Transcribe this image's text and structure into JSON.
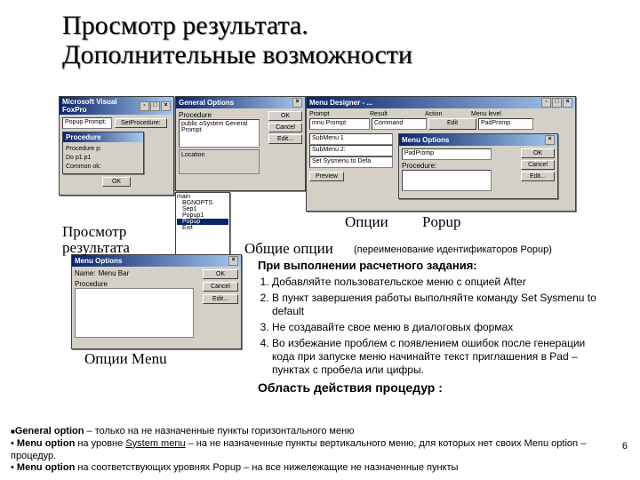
{
  "title_line1": "Просмотр результата.",
  "title_line2": "Дополнительные возможности",
  "labels": {
    "options": "Опции",
    "popup": "Popup",
    "general_options": "Общие опции",
    "popup_rename": "(переименование идентификаторов Popup)",
    "view_result": "Просмотр результата",
    "options_menu": "Опции Menu"
  },
  "text": {
    "heading1": "При выполнении расчетного задания:",
    "heading2": "Область действия процедур :",
    "steps": [
      "Добавляйте пользовательское меню с опцией After",
      "В пункт завершения работы выполняйте команду Set Sysmenu to default",
      "Не создавайте свое меню в диалоговых формах",
      "Во избежание проблем с появлением ошибок после генерации кода при запуске меню начинайте текст приглашения в Pad – пунктах с пробела или цифры."
    ]
  },
  "footer": {
    "b1_strong": "General option",
    "b1_text": " – только на не назначенные пункты горизонтального меню",
    "b2a": "Menu option",
    "b2b": " на уровне ",
    "b2c": "System menu",
    "b2d": " – на не назначенные пункты вертикального меню, для которых нет своих Menu option – процедур.",
    "b3a": "Menu option",
    "b3b": " на соответствующих уровнях ",
    "b3c": "Popup",
    "b3d": " – на все нижележащие не назначенные пункты"
  },
  "page_number": "6",
  "win_vfp": {
    "title": "Microsoft Visual FoxPro",
    "prompt_lbl": "Popup Prompt:",
    "prompt_btn": "SetProcedure:",
    "sub_title": "Procedure",
    "lines": [
      "Procedure p:",
      "Do p1.p1",
      "Common ok:"
    ],
    "btn_ok": "OK"
  },
  "win_general": {
    "title": "General Options",
    "proc_label": "Procedure",
    "proc_body": "public oSystem General Prompt",
    "loc_label": "Location",
    "btn_ok": "OK",
    "btn_cancel": "Cancel",
    "btn_edit": "Edit..."
  },
  "win_tree": {
    "items": [
      "main",
      "BGNOPTS",
      "Sep1",
      "Popup1",
      "Popup",
      "Exit"
    ]
  },
  "win_menudes": {
    "title": "Menu Designer - ...",
    "col_prompt": "Prompt",
    "col_result": "Result",
    "col_action": "Action",
    "col_menulevel": "Menu level",
    "row_prompt": "mnu Prompt",
    "row_result": "Command",
    "row_action": "Edit",
    "row_level": "PadPromp",
    "sub_items": [
      "SubMenu 1",
      "SubMenu 2:",
      "Set Sysmenu to Defa"
    ],
    "btn_preview": "Preview",
    "btn_edit": "Edit...",
    "mopt_title": "Menu Options",
    "mopt_name": "PadPromp",
    "mopt_proc": "Procedure:"
  },
  "win_mopt": {
    "title": "Menu Options",
    "name_lbl": "Name:",
    "name_val": "Menu Bar",
    "proc_lbl": "Procedure",
    "btn_ok": "OK",
    "btn_cancel": "Cancel",
    "btn_edit": "Edit..."
  }
}
